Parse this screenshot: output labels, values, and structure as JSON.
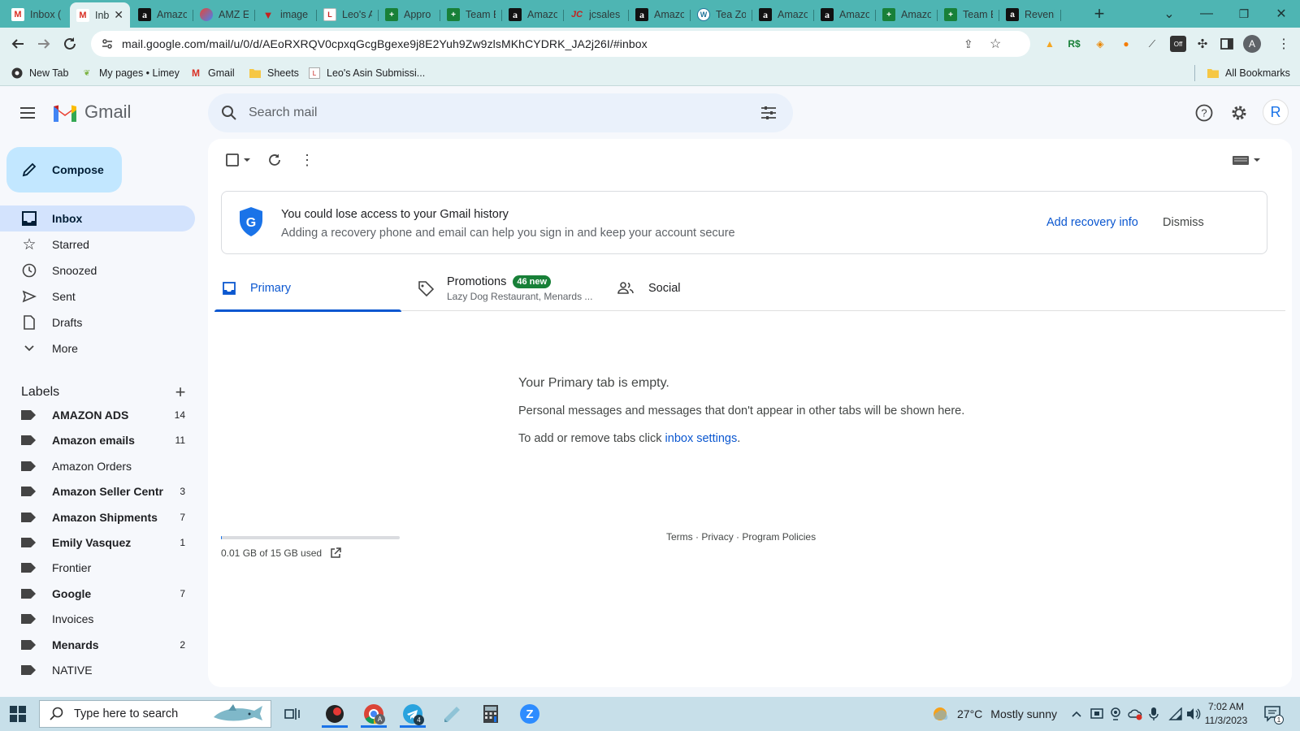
{
  "browser": {
    "tabs": [
      {
        "title": "Inbox (",
        "icon": "gmail-icon"
      },
      {
        "title": "Inb",
        "icon": "gmail-icon",
        "active": true
      },
      {
        "title": "Amazo",
        "icon": "amazon-icon"
      },
      {
        "title": "AMZ E",
        "icon": "edge-icon"
      },
      {
        "title": "image",
        "icon": "v-icon"
      },
      {
        "title": "Leo's A",
        "icon": "leo-icon"
      },
      {
        "title": "Appro",
        "icon": "sheets-icon"
      },
      {
        "title": "Team E",
        "icon": "sheets-icon"
      },
      {
        "title": "Amazo",
        "icon": "amazon-icon"
      },
      {
        "title": "jcsales",
        "icon": "jc-icon"
      },
      {
        "title": "Amazo",
        "icon": "amazon-icon"
      },
      {
        "title": "Tea Zo",
        "icon": "wordpress-icon"
      },
      {
        "title": "Amazo",
        "icon": "amazon-icon"
      },
      {
        "title": "Amazo",
        "icon": "amazon-icon"
      },
      {
        "title": "Amazo",
        "icon": "sheets-icon"
      },
      {
        "title": "Team E",
        "icon": "sheets-icon"
      },
      {
        "title": "Reveni",
        "icon": "amazon-icon"
      }
    ],
    "url": "mail.google.com/mail/u/0/d/AEoRXRQV0cpxqGcgBgexe9j8E2Yuh9Zw9zlsMKhCYDRK_JA2j26I/#inbox",
    "profile_initial": "A",
    "bookmarks": [
      {
        "label": "New Tab",
        "icon": "chrome-icon"
      },
      {
        "label": "My pages • Limey",
        "icon": "leaf-icon"
      },
      {
        "label": "Gmail",
        "icon": "gmail-icon"
      },
      {
        "label": "Sheets",
        "icon": "folder-icon"
      },
      {
        "label": "Leo's Asin Submissi...",
        "icon": "leo-icon"
      }
    ],
    "all_bookmarks": "All Bookmarks"
  },
  "gmail": {
    "logo_text": "Gmail",
    "search_placeholder": "Search mail",
    "avatar_initial": "R",
    "compose_label": "Compose",
    "nav": [
      {
        "label": "Inbox",
        "icon": "inbox-icon",
        "active": true
      },
      {
        "label": "Starred",
        "icon": "star-icon"
      },
      {
        "label": "Snoozed",
        "icon": "clock-icon"
      },
      {
        "label": "Sent",
        "icon": "send-icon"
      },
      {
        "label": "Drafts",
        "icon": "draft-icon"
      },
      {
        "label": "More",
        "icon": "chevron-down-icon"
      }
    ],
    "labels_heading": "Labels",
    "labels": [
      {
        "name": "AMAZON ADS",
        "count": "14",
        "bold": true
      },
      {
        "name": "Amazon emails",
        "count": "11",
        "bold": true
      },
      {
        "name": "Amazon Orders",
        "count": "",
        "bold": false
      },
      {
        "name": "Amazon Seller Centr",
        "count": "3",
        "bold": true
      },
      {
        "name": "Amazon Shipments",
        "count": "7",
        "bold": true
      },
      {
        "name": "Emily Vasquez",
        "count": "1",
        "bold": true
      },
      {
        "name": "Frontier",
        "count": "",
        "bold": false
      },
      {
        "name": "Google",
        "count": "7",
        "bold": true
      },
      {
        "name": "Invoices",
        "count": "",
        "bold": false
      },
      {
        "name": "Menards",
        "count": "2",
        "bold": true
      },
      {
        "name": "NATIVE",
        "count": "",
        "bold": false
      }
    ],
    "banner": {
      "title": "You could lose access to your Gmail history",
      "subtitle": "Adding a recovery phone and email can help you sign in and keep your account secure",
      "primary_action": "Add recovery info",
      "secondary_action": "Dismiss"
    },
    "inbox_tabs": {
      "primary": "Primary",
      "promotions": "Promotions",
      "promotions_badge": "46 new",
      "promotions_senders": "Lazy Dog Restaurant, Menards ...",
      "social": "Social"
    },
    "empty_state": {
      "title": "Your Primary tab is empty.",
      "line1": "Personal messages and messages that don't appear in other tabs will be shown here.",
      "line2_prefix": "To add or remove tabs click ",
      "line2_link": "inbox settings",
      "line2_suffix": "."
    },
    "storage": {
      "used_text": "0.01 GB of 15 GB used",
      "used_fraction": 0.0007
    },
    "footer": {
      "terms": "Terms",
      "privacy": "Privacy",
      "policies": "Program Policies",
      "sep": "·"
    }
  },
  "taskbar": {
    "search_placeholder": "Type here to search",
    "weather_temp": "27°C",
    "weather_desc": "Mostly sunny",
    "time": "7:02 AM",
    "date": "11/3/2023",
    "notification_count": "1",
    "chrome_badge": "A",
    "telegram_badge": "4"
  },
  "colors": {
    "tabstrip": "#4eb5b3",
    "toolbar": "#e3f1f2",
    "gmail_accent": "#0b57d0",
    "compose_bg": "#c2e7ff",
    "active_nav": "#d3e3fd",
    "promo_badge": "#188038"
  }
}
